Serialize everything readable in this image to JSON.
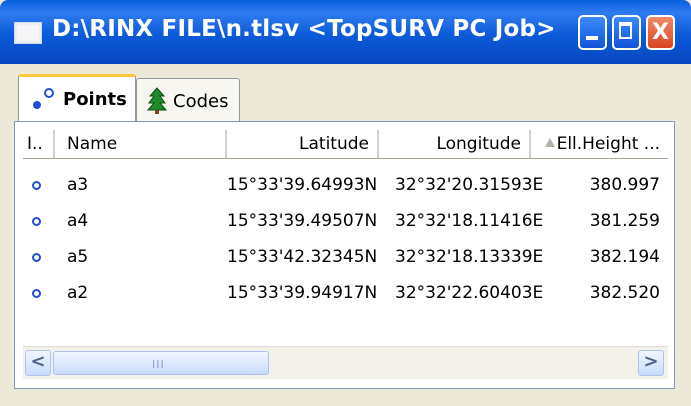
{
  "window": {
    "title": "D:\\RINX FILE\\n.tlsv  <TopSURV PC Job>",
    "titlebar_color": "#0c5ad8",
    "close_glyph": "X"
  },
  "tabs": [
    {
      "label": "Points",
      "icon": "points-icon",
      "selected": true
    },
    {
      "label": "Codes",
      "icon": "tree-icon",
      "selected": false
    }
  ],
  "table": {
    "columns": {
      "idx": "I..",
      "name": "Name",
      "lat": "Latitude",
      "lon": "Longitude",
      "ell": "Ell.Height ..."
    },
    "rows": [
      {
        "name": "a3",
        "lat": "15°33'39.64993N",
        "lon": "32°32'20.31593E",
        "ell": "380.997"
      },
      {
        "name": "a4",
        "lat": "15°33'39.49507N",
        "lon": "32°32'18.11416E",
        "ell": "381.259"
      },
      {
        "name": "a5",
        "lat": "15°33'42.32345N",
        "lon": "32°32'18.13339E",
        "ell": "382.194"
      },
      {
        "name": "a2",
        "lat": "15°33'39.94917N",
        "lon": "32°32'22.60403E",
        "ell": "382.520"
      }
    ]
  },
  "scrollbar": {
    "left_arrow": "<",
    "right_arrow": ">",
    "grip": "III"
  }
}
